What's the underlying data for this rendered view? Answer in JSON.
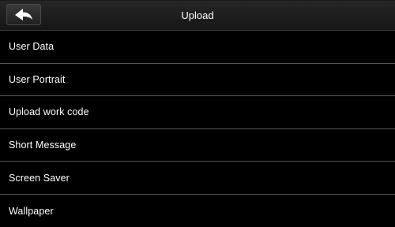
{
  "header": {
    "title": "Upload",
    "back_icon": "back-arrow-icon"
  },
  "menu": {
    "items": [
      {
        "label": "User Data"
      },
      {
        "label": "User Portrait"
      },
      {
        "label": "Upload work code"
      },
      {
        "label": "Short Message"
      },
      {
        "label": "Screen Saver"
      },
      {
        "label": "Wallpaper"
      }
    ]
  },
  "colors": {
    "background": "#000000",
    "text": "#ffffff",
    "divider": "#555555"
  }
}
